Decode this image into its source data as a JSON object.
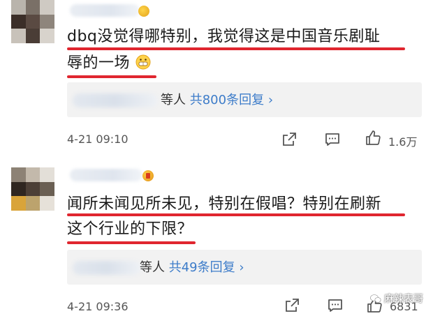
{
  "comments": [
    {
      "text_line1": "dbq没觉得哪特别，我觉得这是中国音乐剧耻",
      "text_line2": "辱的一场",
      "emoji": "grin-emoji",
      "reply_suffix": "等人",
      "reply_count": "共800条回复",
      "timestamp": "4-21 09:10",
      "likes": "1.6万",
      "avatar_colors": [
        "#b9b4ac",
        "#7a7067",
        "#cfcac3",
        "#3b2e28",
        "#5a4a42",
        "#8e857c",
        "#c8c2ba",
        "#4a3d36",
        "#d8d3cc"
      ]
    },
    {
      "text_line1": "闻所未闻见所未见，特别在假唱？特别在刷新",
      "text_line2": "这个行业的下限？",
      "reply_suffix": "等人",
      "reply_count": "共49条回复",
      "timestamp": "4-21 09:36",
      "likes": "6831",
      "avatar_colors": [
        "#8d8275",
        "#c3b9ab",
        "#e3dfd8",
        "#2f2620",
        "#4c3f36",
        "#6a5f53",
        "#d9a43a",
        "#bca36d",
        "#e6e1d9"
      ]
    }
  ],
  "watermark": "麻辣表哥",
  "colors": {
    "accent_red": "#e0262f",
    "link_blue": "#3d7cc9",
    "reply_bg": "#f2f2f2"
  }
}
